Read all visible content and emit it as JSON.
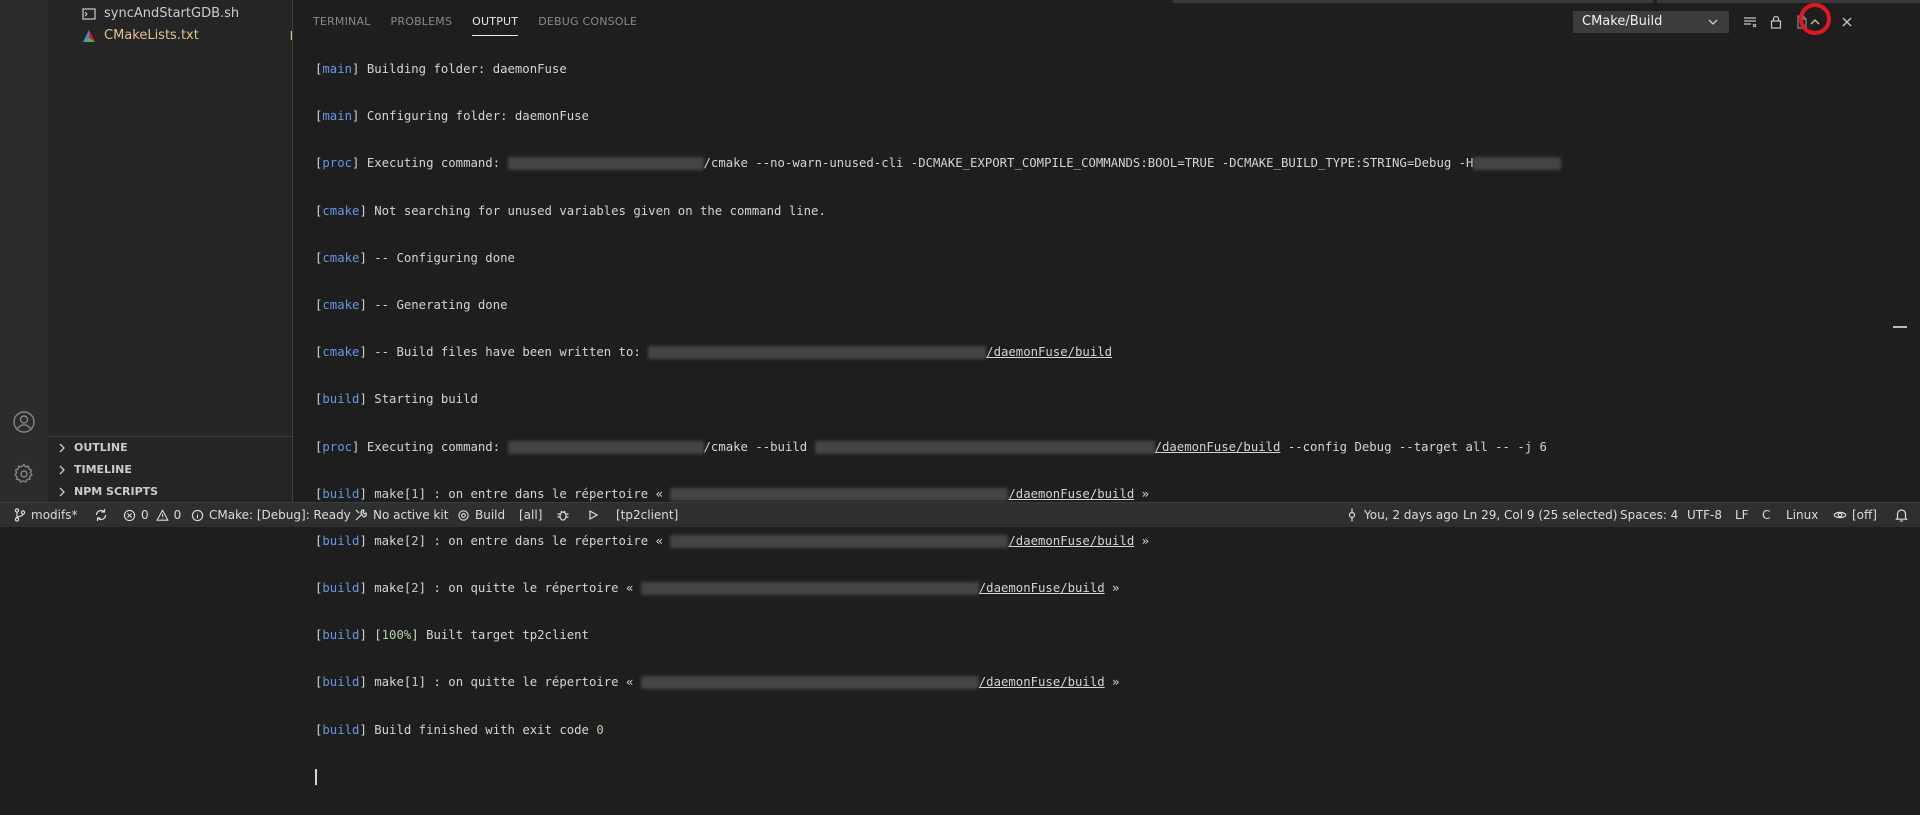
{
  "explorer": {
    "files": [
      {
        "name": "syncAndStartGDB.sh",
        "status": ""
      },
      {
        "name": "CMakeLists.txt",
        "status": "M"
      }
    ],
    "sections": [
      "OUTLINE",
      "TIMELINE",
      "NPM SCRIPTS"
    ]
  },
  "panel": {
    "tabs": [
      "TERMINAL",
      "PROBLEMS",
      "OUTPUT",
      "DEBUG CONSOLE"
    ],
    "active_tab": "OUTPUT",
    "channel": "CMake/Build"
  },
  "output": {
    "l1_tag": "main",
    "l1_text": " Building folder: daemonFuse",
    "l2_tag": "main",
    "l2_text": " Configuring folder: daemonFuse",
    "l3_tag": "proc",
    "l3_pre": " Executing command: ",
    "l3_mid": "/cmake --no-warn-unused-cli -DCMAKE_EXPORT_COMPILE_COMMANDS:BOOL=TRUE -DCMAKE_BUILD_TYPE:STRING=Debug -H",
    "l4_tag": "cmake",
    "l4_text": " Not searching for unused variables given on the command line.",
    "l5_tag": "cmake",
    "l5_text": " -- Configuring done",
    "l6_tag": "cmake",
    "l6_text": " -- Generating done",
    "l7_tag": "cmake",
    "l7_pre": " -- Build files have been written to: ",
    "l7_path": "/daemonFuse/build",
    "l8_tag": "build",
    "l8_text": " Starting build",
    "l9_tag": "proc",
    "l9_pre": " Executing command: ",
    "l9_mid": "/cmake --build ",
    "l9_path": "/daemonFuse/build",
    "l9_post": " --config Debug --target all -- -j 6",
    "l10_tag": "build",
    "l10_a": " make[",
    "l10_n": "1",
    "l10_b": "] : on entre dans le répertoire « ",
    "l10_path": "/daemonFuse/build",
    "l10_post": " »",
    "l11_tag": "build",
    "l11_a": " make[",
    "l11_n": "2",
    "l11_b": "] : on entre dans le répertoire « ",
    "l11_path": "/daemonFuse/build",
    "l11_post": " »",
    "l12_tag": "build",
    "l12_a": " make[",
    "l12_n": "2",
    "l12_b": "] : on quitte le répertoire « ",
    "l12_path": "/daemonFuse/build",
    "l12_post": " »",
    "l13_tag": "build",
    "l13_pre": " [",
    "l13_pct": "100%",
    "l13_post": "] Built target tp2client",
    "l14_tag": "build",
    "l14_a": " make[",
    "l14_n": "1",
    "l14_b": "] : on quitte le répertoire « ",
    "l14_path": "/daemonFuse/build",
    "l14_post": " »",
    "l15_tag": "build",
    "l15_pre": " Build finished with exit code ",
    "l15_code": "0"
  },
  "statusbar": {
    "branch": "modifs*",
    "errors": "0",
    "warnings": "0",
    "cmake_status": "CMake: [Debug]: Ready",
    "kit": "No active kit",
    "build": "Build",
    "target_all": "[all]",
    "launch_target": "[tp2client]",
    "blame": "You, 2 days ago",
    "cursor": "Ln 29, Col 9 (25 selected)",
    "spaces": "Spaces: 4",
    "encoding": "UTF-8",
    "eol": "LF",
    "language": "C",
    "os": "Linux",
    "tail": "[off]"
  },
  "colors": {
    "tag": "#6796e6",
    "accent_red": "#e5161f",
    "modified": "#e2c08d"
  }
}
